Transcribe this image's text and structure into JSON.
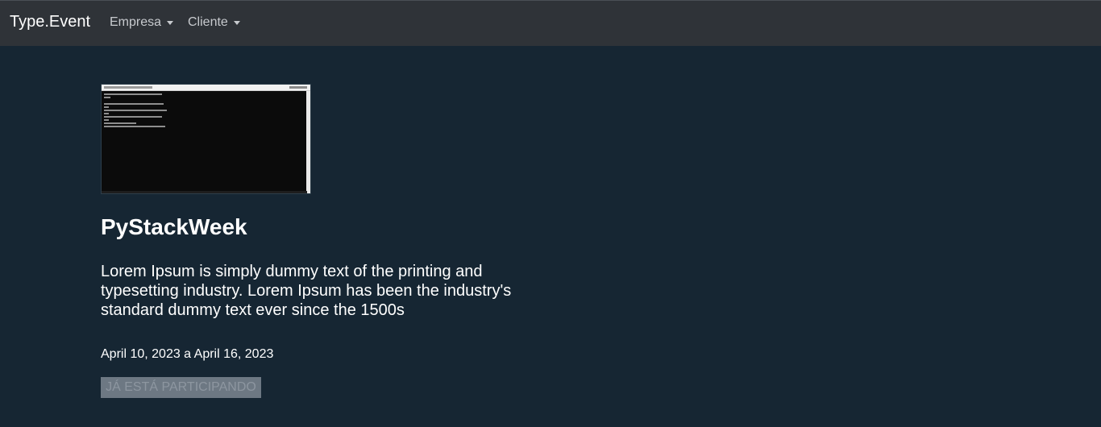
{
  "navbar": {
    "brand": "Type.Event",
    "menus": [
      {
        "label": "Empresa"
      },
      {
        "label": "Cliente"
      }
    ]
  },
  "event": {
    "title": "PyStackWeek",
    "description": "Lorem Ipsum is simply dummy text of the printing and typesetting industry. Lorem Ipsum has been the industry's standard dummy text ever since the 1500s",
    "dates": "April 10, 2023 a April 16, 2023",
    "action_label": "JÁ ESTÁ PARTICIPANDO"
  },
  "colors": {
    "page_background": "#162633",
    "navbar_background": "#2f3338",
    "disabled_button": "#6d7883"
  },
  "icons": {
    "dropdown": "caret-down-icon"
  }
}
